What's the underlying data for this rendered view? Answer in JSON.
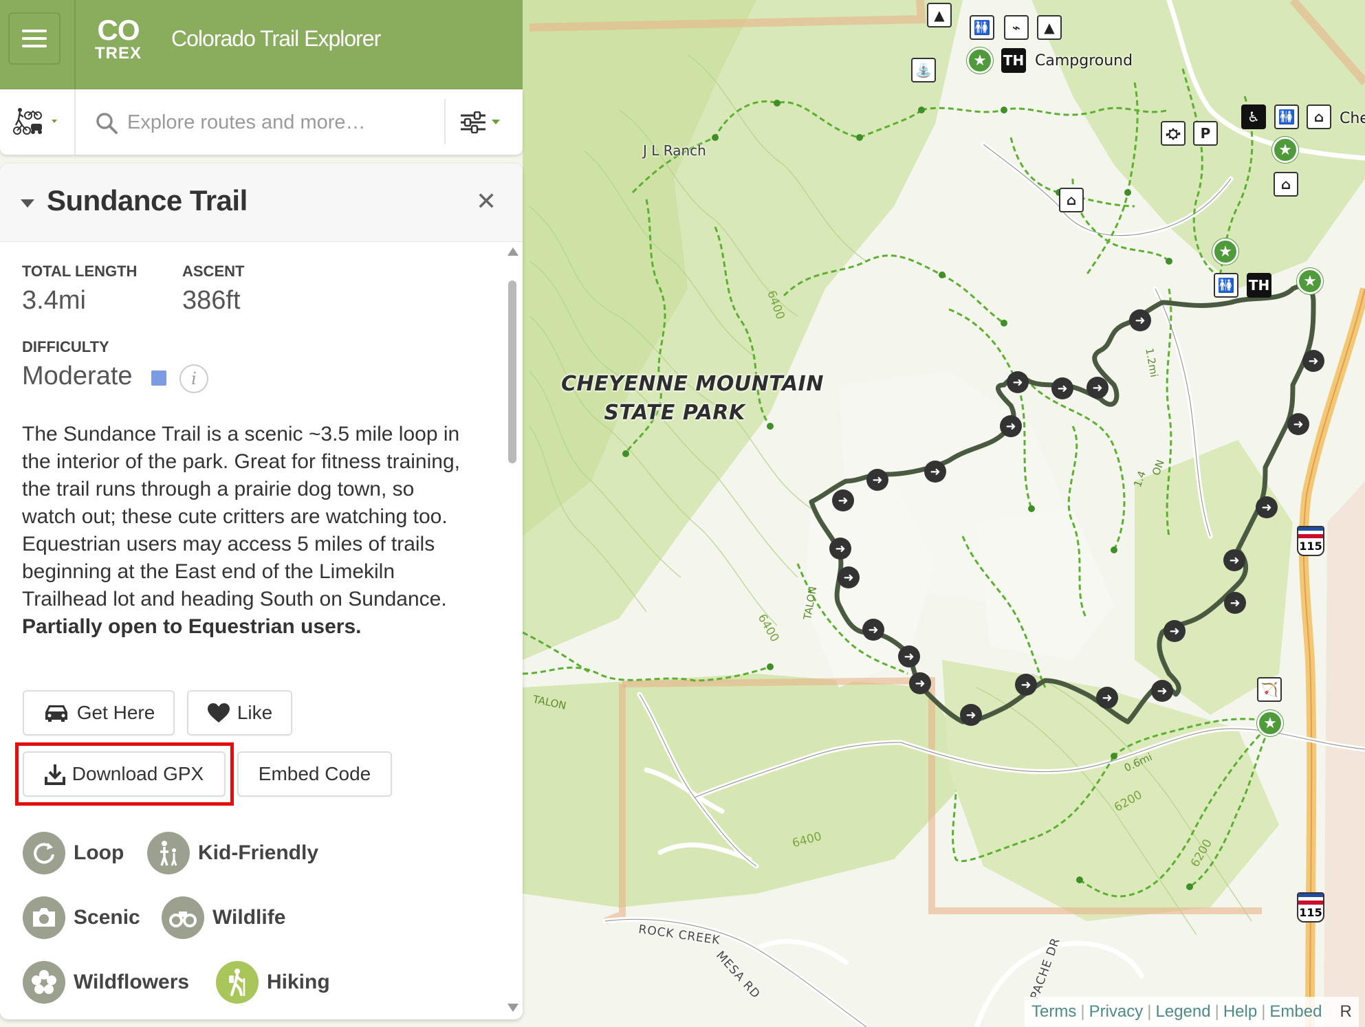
{
  "header": {
    "logo_co": "CO",
    "logo_trex": "TREX",
    "app_title": "Colorado Trail Explorer"
  },
  "search": {
    "placeholder": "Explore routes and more…"
  },
  "trail": {
    "title": "Sundance Trail",
    "total_length_label": "TOTAL LENGTH",
    "total_length_value": "3.4mi",
    "ascent_label": "ASCENT",
    "ascent_value": "386ft",
    "difficulty_label": "DIFFICULTY",
    "difficulty_value": "Moderate",
    "difficulty_color": "#7b9be3",
    "description": "The Sundance Trail is a scenic ~3.5 mile loop in the interior of the park.  Great for fitness training, the trail runs through a prairie dog town, so watch out; these cute critters are watching too. Equestrian users may access 5 miles of trails beginning at the East end of the Limekiln Trailhead lot and heading South on Sundance.",
    "description_bold": "Partially open to Equestrian users."
  },
  "buttons": {
    "get_here": "Get Here",
    "like": "Like",
    "download_gpx": "Download GPX",
    "embed_code": "Embed Code"
  },
  "tags": [
    {
      "label": "Loop",
      "icon": "loop-icon"
    },
    {
      "label": "Kid-Friendly",
      "icon": "family-icon"
    },
    {
      "label": "Scenic",
      "icon": "camera-icon"
    },
    {
      "label": "Wildlife",
      "icon": "binoculars-icon"
    },
    {
      "label": "Wildflowers",
      "icon": "flower-icon"
    },
    {
      "label": "Hiking",
      "icon": "hiker-icon"
    }
  ],
  "map": {
    "park_label_line1": "CHEYENNE MOUNTAIN",
    "park_label_line2": "STATE PARK",
    "ranch_label": "J L Ranch",
    "campground_label": "Campground",
    "cheyenne_partial": "Che",
    "road_label": "ROCK CREEK MESA RD",
    "apache_label": "PACHE DR",
    "talon_label_1": "TALON",
    "talon_label_2": "TALON",
    "contour_6400_a": "6400",
    "contour_6400_b": "6400",
    "contour_6400_c": "6400",
    "contour_6200_a": "6200",
    "contour_6200_b": "6200",
    "dist_12mi": "1.2mi",
    "dist_06mi": "0.6mi",
    "dist_14": "1.4",
    "dist_on": "ON",
    "poi_th": "TH",
    "poi_p": "P",
    "highway_115": "115",
    "trail_color": "#4a5a40",
    "green_trail_color": "#5cb030"
  },
  "attribution": {
    "terms": "Terms",
    "privacy": "Privacy",
    "legend": "Legend",
    "help": "Help",
    "embed": "Embed",
    "trunc": "R"
  }
}
